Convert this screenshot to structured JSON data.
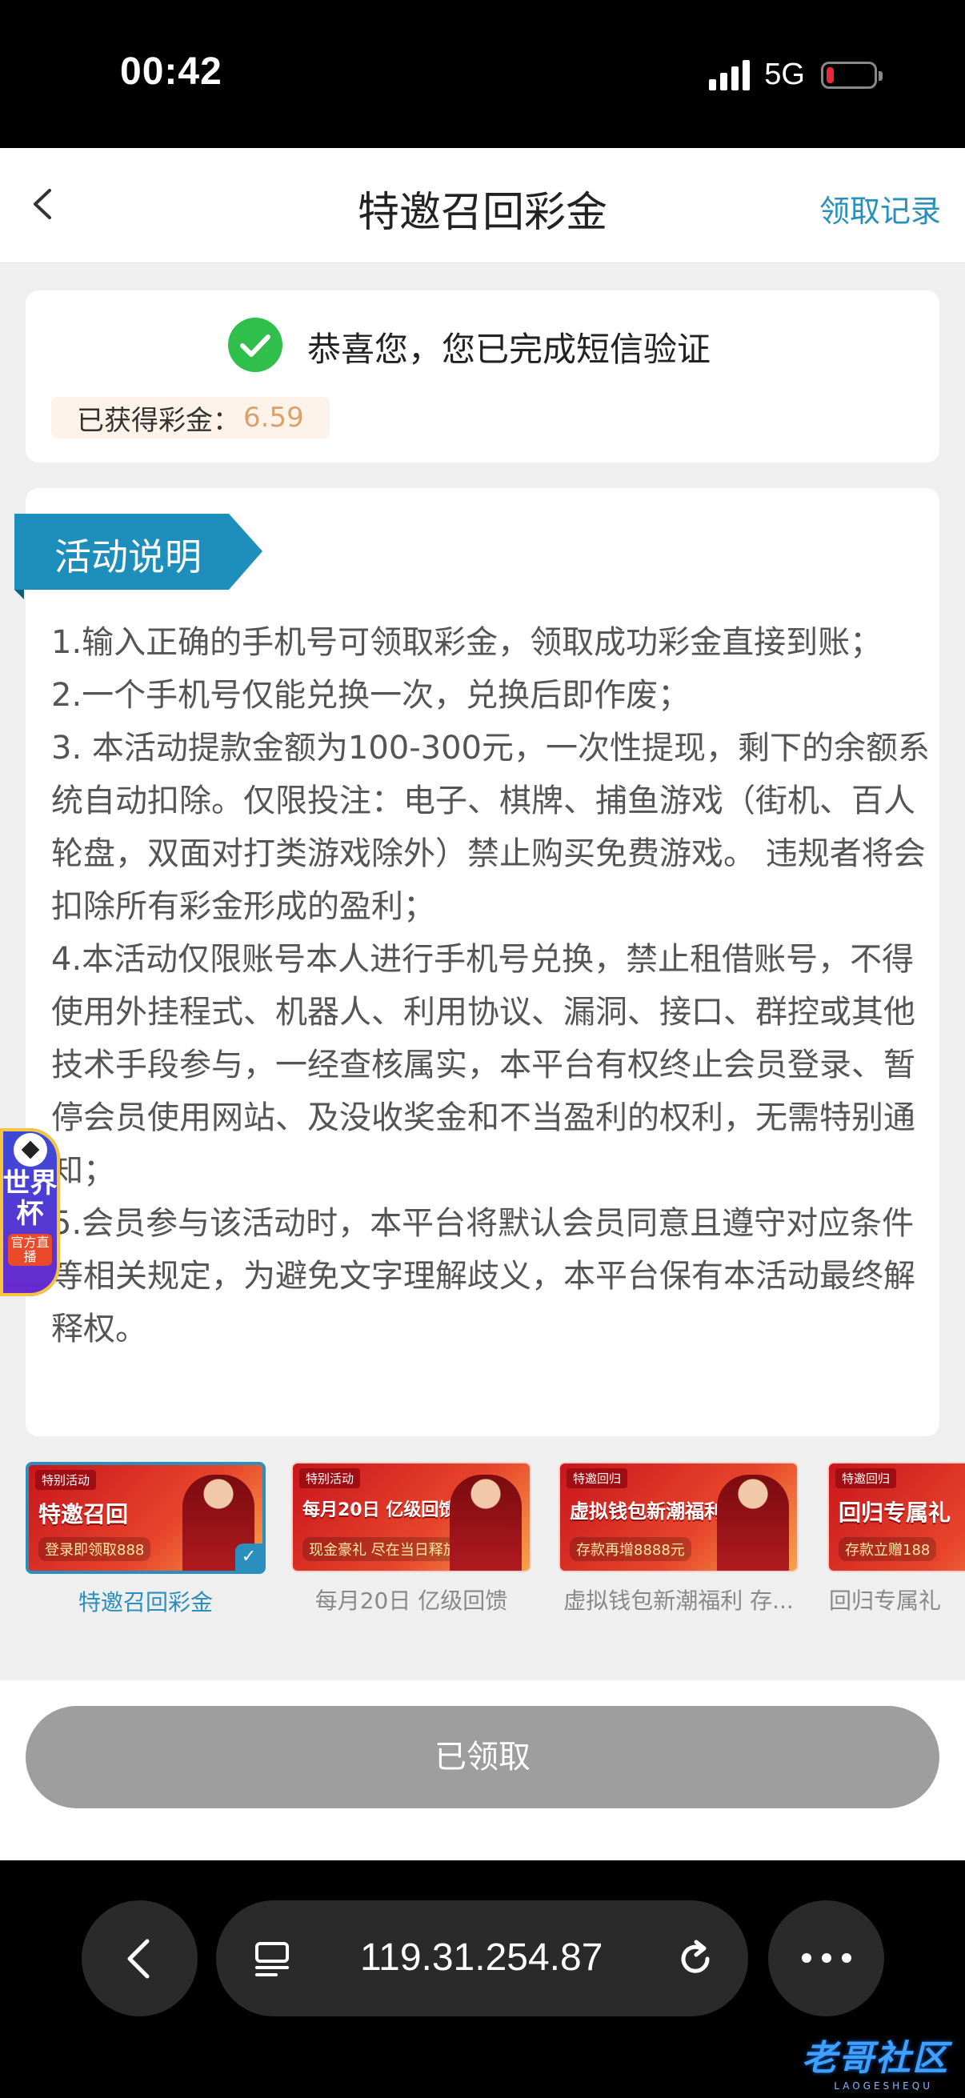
{
  "status_bar": {
    "time": "00:42",
    "network": "5G",
    "battery_level": 0.1,
    "battery_color": "#e8273a"
  },
  "header": {
    "title": "特邀召回彩金",
    "records_link": "领取记录",
    "back_icon": "chevron-left-icon"
  },
  "verify": {
    "message": "恭喜您，您已完成短信验证",
    "reward_label": "已获得彩金：",
    "reward_value": "6.59",
    "check_icon": "check-circle-icon",
    "check_color": "#2fbf4a"
  },
  "rules": {
    "title": "活动说明",
    "items": [
      "1.输入正确的手机号可领取彩金，领取成功彩金直接到账；",
      "2.一个手机号仅能兑换一次，兑换后即作废；",
      "3. 本活动提款金额为100-300元，一次性提现，剩下的余额系统自动扣除。仅限投注：电子、棋牌、捕鱼游戏（街机、百人轮盘，双面对打类游戏除外）禁止购买免费游戏。 违规者将会扣除所有彩金形成的盈利；",
      "4.本活动仅限账号本人进行手机号兑换，禁止租借账号，不得使用外挂程式、机器人、利用协议、漏洞、接口、群控或其他技术手段参与，一经查核属实，本平台有权终止会员登录、暂停会员使用网站、及没收奖金和不当盈利的权利，无需特别通知；",
      "5.会员参与该活动时，本平台将默认会员同意且遵守对应条件等相关规定，为避免文字理解歧义，本平台保有本活动最终解释权。"
    ]
  },
  "world_cup": {
    "title": "世界杯",
    "sub": "官方直播"
  },
  "banners": [
    {
      "tag": "特别活动",
      "headline": "特邀召回",
      "sub": "登录即领取888",
      "caption": "特邀召回彩金",
      "active": true
    },
    {
      "tag": "特别活动",
      "headline": "每月20日 亿级回馈",
      "sub": "现金豪礼 尽在当日释放",
      "caption": "每月20日 亿级回馈",
      "active": false
    },
    {
      "tag": "特邀回归",
      "headline": "虚拟钱包新潮福利",
      "sub": "存款再增8888元",
      "caption": "虚拟钱包新潮福利 存...",
      "active": false
    },
    {
      "tag": "特邀回归",
      "headline": "回归专属礼",
      "sub": "存款立赠188",
      "caption": "回归专属礼",
      "active": false
    }
  ],
  "claim_button": {
    "label": "已领取",
    "disabled": true
  },
  "browser": {
    "url": "119.31.254.87",
    "back_icon": "chevron-left-icon",
    "tabs_icon": "page-menu-icon",
    "reload_icon": "reload-icon",
    "more_icon": "more-dots-icon"
  },
  "watermark": {
    "text": "老哥社区",
    "sub": "LAOGESHEQU"
  }
}
